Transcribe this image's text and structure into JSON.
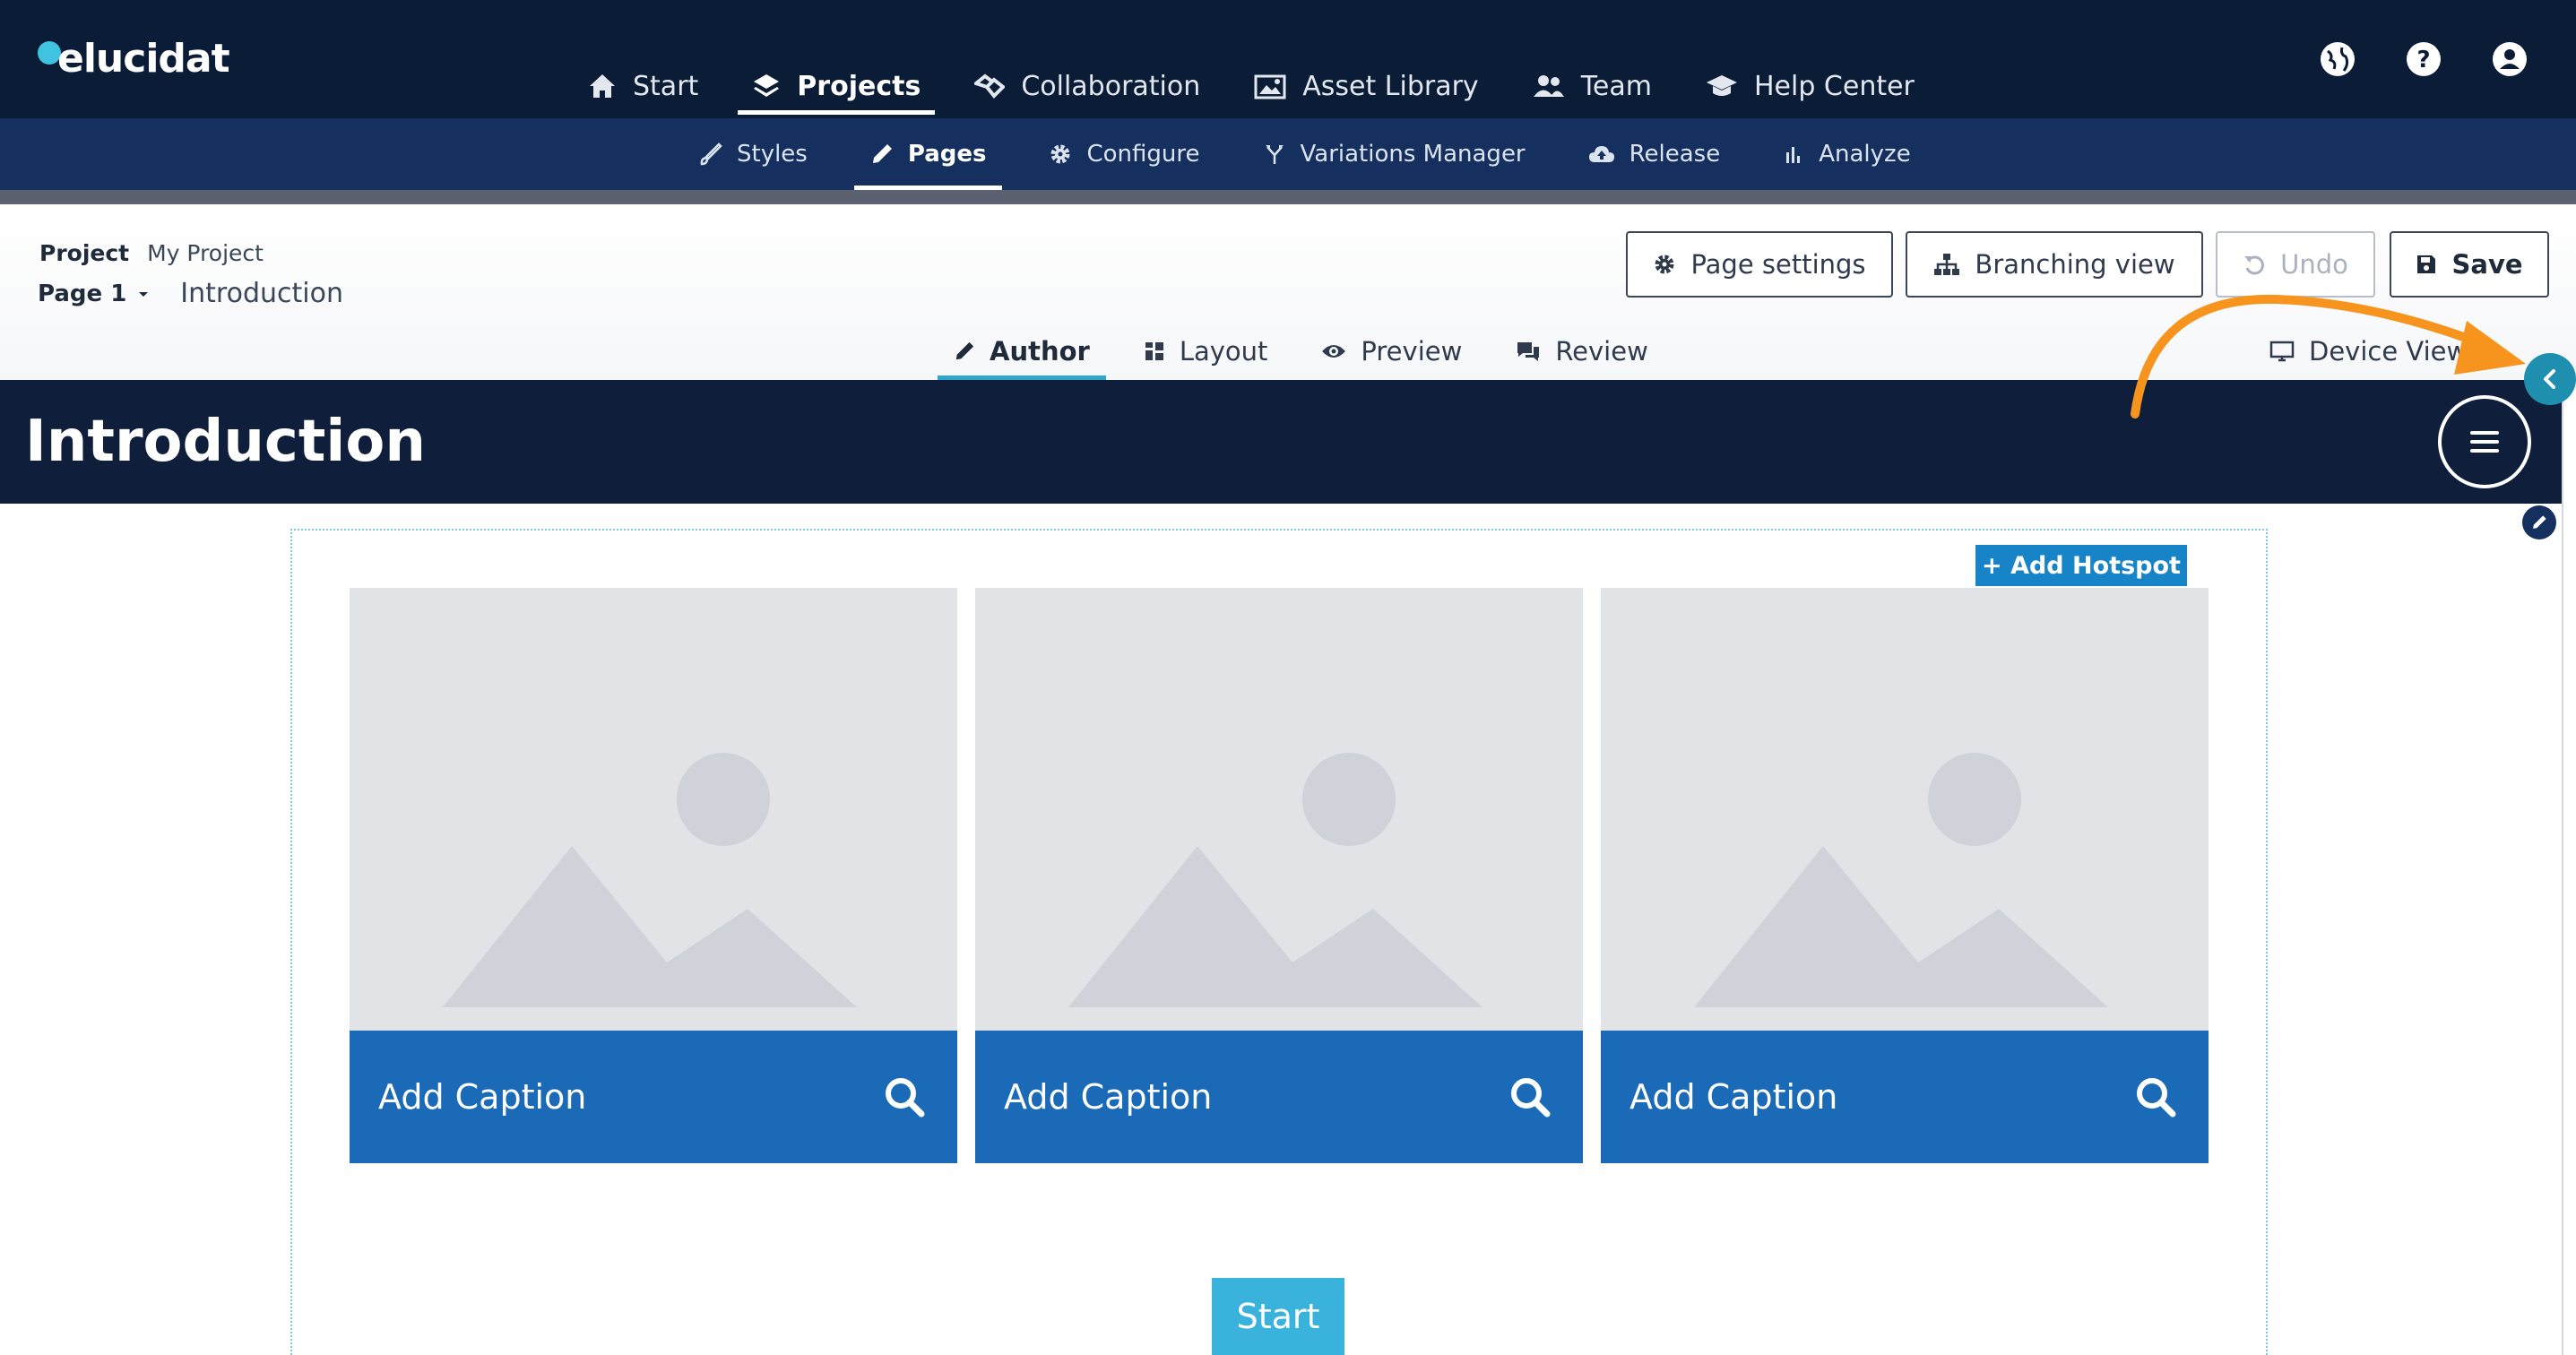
{
  "app": {
    "logo_text": "elucidat"
  },
  "topnav": {
    "items": [
      {
        "label": "Start",
        "icon": "home-icon"
      },
      {
        "label": "Projects",
        "icon": "layers-icon",
        "active": true
      },
      {
        "label": "Collaboration",
        "icon": "handshake-icon"
      },
      {
        "label": "Asset Library",
        "icon": "images-icon"
      },
      {
        "label": "Team",
        "icon": "users-icon"
      },
      {
        "label": "Help Center",
        "icon": "graduation-cap-icon"
      }
    ],
    "right_icons": [
      "globe-icon",
      "help-icon",
      "account-icon"
    ]
  },
  "subnav": {
    "items": [
      {
        "label": "Styles",
        "icon": "brush-icon"
      },
      {
        "label": "Pages",
        "icon": "pencil-icon",
        "active": true
      },
      {
        "label": "Configure",
        "icon": "gear-icon"
      },
      {
        "label": "Variations Manager",
        "icon": "branch-icon"
      },
      {
        "label": "Release",
        "icon": "cloud-upload-icon"
      },
      {
        "label": "Analyze",
        "icon": "bar-chart-icon"
      }
    ]
  },
  "breadcrumb": {
    "project_key": "Project",
    "project_name": "My Project",
    "page_label": "Page 1",
    "page_title": "Introduction"
  },
  "header_buttons": {
    "page_settings": "Page settings",
    "branching_view": "Branching view",
    "undo": "Undo",
    "save": "Save"
  },
  "mode_tabs": [
    {
      "label": "Author",
      "icon": "pencil-icon",
      "active": true
    },
    {
      "label": "Layout",
      "icon": "grid-icon"
    },
    {
      "label": "Preview",
      "icon": "eye-icon"
    },
    {
      "label": "Review",
      "icon": "comments-icon"
    }
  ],
  "device_view": "Device View",
  "stage": {
    "title": "Introduction",
    "add_hotspot": "+ Add Hotspot",
    "cards": [
      {
        "caption": "Add Caption"
      },
      {
        "caption": "Add Caption"
      },
      {
        "caption": "Add Caption"
      }
    ],
    "start_button": "Start"
  },
  "colors": {
    "topnav_bg": "#0b1c36",
    "subnav_bg": "#15305e",
    "caption_bg": "#1a6ab7",
    "hotspot_bg": "#1784c7",
    "start_bg": "#39b3dc",
    "annotation_arrow": "#f7941d"
  }
}
